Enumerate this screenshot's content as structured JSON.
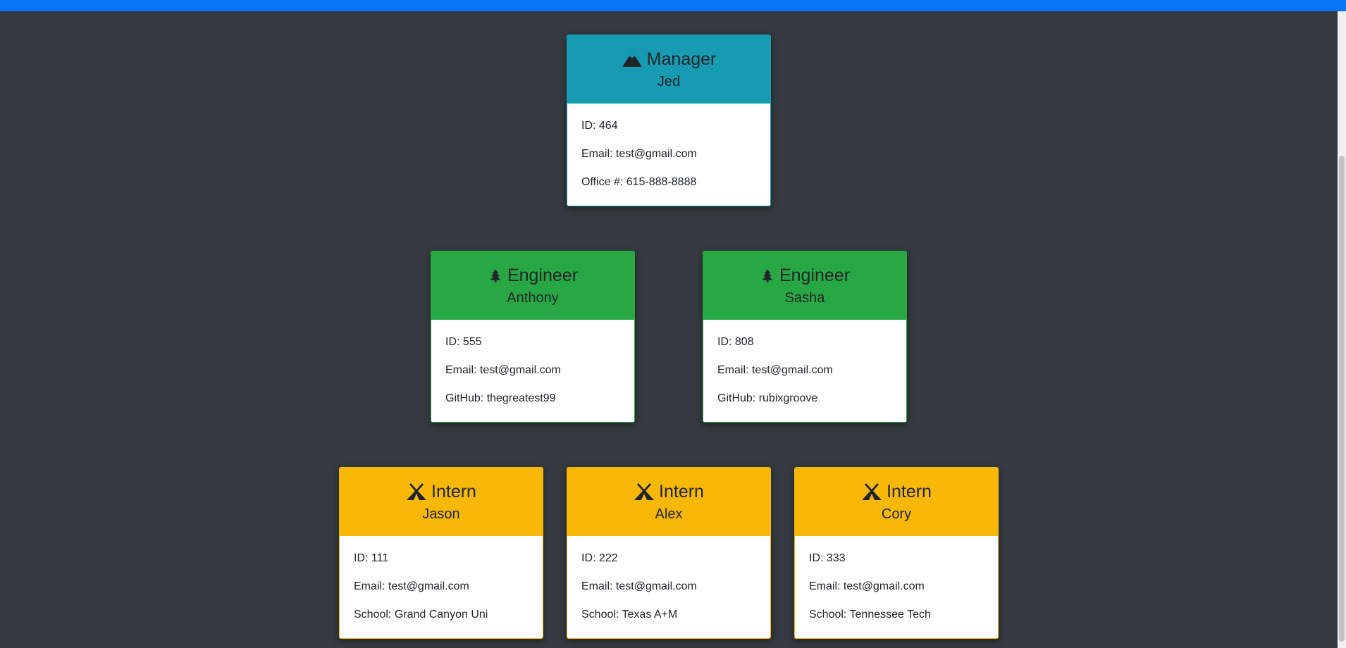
{
  "colors": {
    "background": "#343a40",
    "top_bar": "#0a74f7",
    "manager": "#179bb2",
    "engineer": "#28a745",
    "intern": "#f7b807"
  },
  "manager": {
    "icon": "mountain-icon",
    "role": "Manager",
    "name": "Jed",
    "id": "ID: 464",
    "email": "Email: test@gmail.com",
    "extra": "Office #: 615-888-8888"
  },
  "engineers": [
    {
      "icon": "tree-icon",
      "role": "Engineer",
      "name": "Anthony",
      "id": "ID: 555",
      "email": "Email: test@gmail.com",
      "extra": "GitHub: thegreatest99"
    },
    {
      "icon": "tree-icon",
      "role": "Engineer",
      "name": "Sasha",
      "id": "ID: 808",
      "email": "Email: test@gmail.com",
      "extra": "GitHub: rubixgroove"
    }
  ],
  "interns": [
    {
      "icon": "tent-icon",
      "role": "Intern",
      "name": "Jason",
      "id": "ID: 111",
      "email": "Email: test@gmail.com",
      "extra": "School: Grand Canyon Uni"
    },
    {
      "icon": "tent-icon",
      "role": "Intern",
      "name": "Alex",
      "id": "ID: 222",
      "email": "Email: test@gmail.com",
      "extra": "School: Texas A+M"
    },
    {
      "icon": "tent-icon",
      "role": "Intern",
      "name": "Cory",
      "id": "ID: 333",
      "email": "Email: test@gmail.com",
      "extra": "School: Tennessee Tech"
    }
  ]
}
